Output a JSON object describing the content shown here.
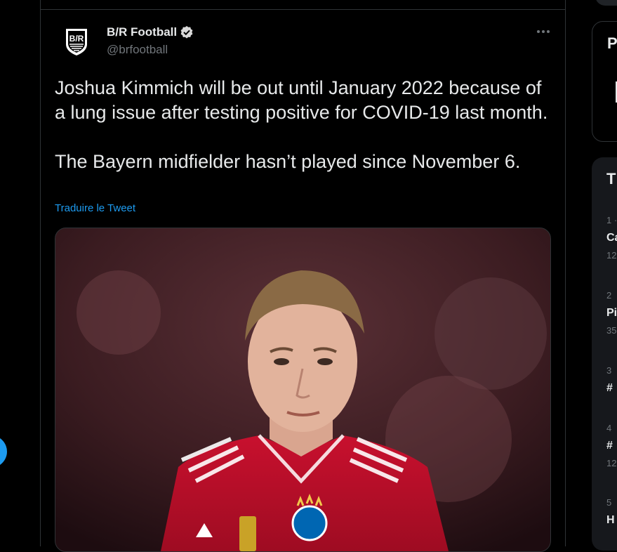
{
  "tweet": {
    "author_name": "B/R Football",
    "handle": "@brfootball",
    "avatar_text": "B/R",
    "text": "Joshua Kimmich will be out until January 2022 because of a lung issue after testing positive for COVID-19 last month.\n\nThe Bayern midfielder hasn’t played since November 6.",
    "translate_label": "Traduire le Tweet",
    "media_label": "Photo of Joshua Kimmich in a Bayern kit"
  },
  "sidebar": {
    "panel_a_heading_visible": "P",
    "trends_heading_visible": "T",
    "trends": [
      {
        "rank": "1 ·",
        "title": "Ca",
        "count": "12"
      },
      {
        "rank": "2",
        "title": "Pi",
        "count": "35"
      },
      {
        "rank": "3",
        "title": "#",
        "count": ""
      },
      {
        "rank": "4",
        "title": "#",
        "count": "12"
      },
      {
        "rank": "5",
        "title": "H",
        "count": ""
      }
    ]
  },
  "colors": {
    "background": "#000000",
    "text": "#e7e9ea",
    "muted": "#71767b",
    "accent": "#1d9bf0",
    "border": "#2f3336",
    "panel": "#16181c"
  }
}
